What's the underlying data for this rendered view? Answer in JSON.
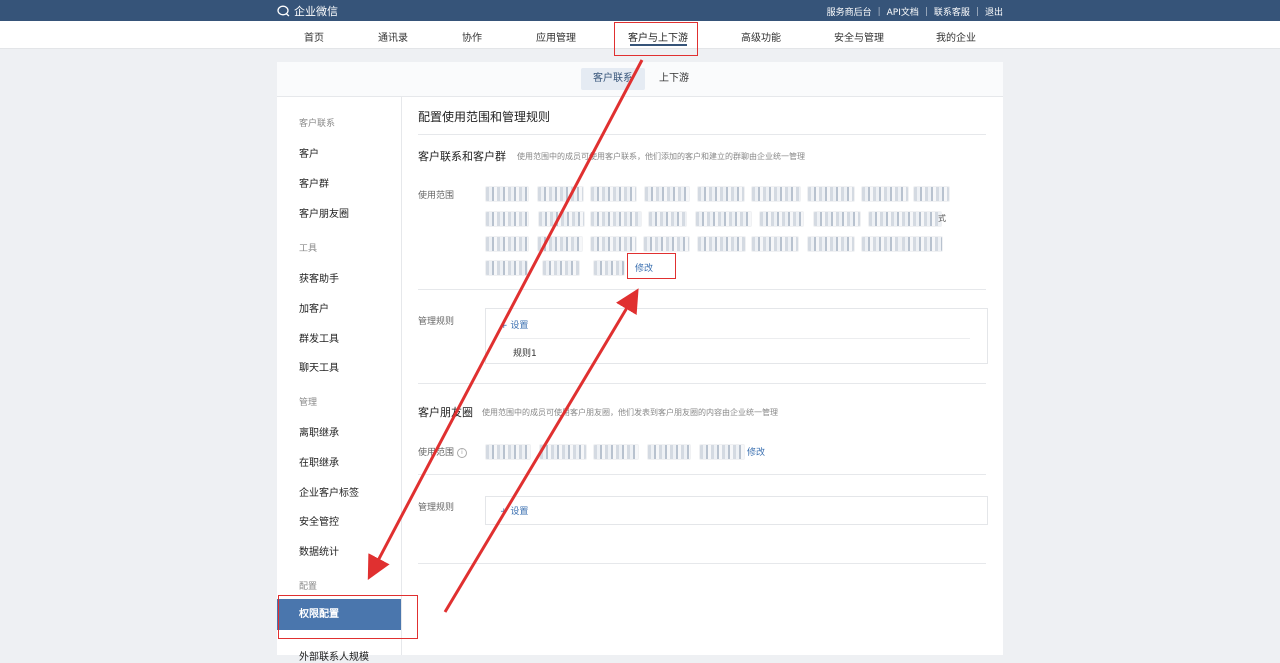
{
  "topbar": {
    "logo_text": "企业微信",
    "links": [
      "服务商后台",
      "API文档",
      "联系客服",
      "退出"
    ]
  },
  "nav": {
    "items": [
      "首页",
      "通讯录",
      "协作",
      "应用管理",
      "客户与上下游",
      "高级功能",
      "安全与管理",
      "我的企业"
    ],
    "active_index": 4
  },
  "subtabs": [
    "客户联系",
    "上下游"
  ],
  "sidebar": {
    "group_customer": "客户联系",
    "item_customer": "客户",
    "item_customer_group": "客户群",
    "item_moments": "客户朋友圈",
    "group_tools": "工具",
    "item_acquire": "获客助手",
    "item_add_customer": "加客户",
    "item_mass_send": "群发工具",
    "item_chat_tools": "聊天工具",
    "group_manage": "管理",
    "item_resign_inherit": "离职继承",
    "item_onjob_inherit": "在职继承",
    "item_tags": "企业客户标签",
    "item_security": "安全管控",
    "item_stats": "数据统计",
    "group_config": "配置",
    "item_permission": "权限配置",
    "item_partial": "外部联系人规模"
  },
  "main": {
    "title": "配置使用范围和管理规则",
    "section1": {
      "title": "客户联系和客户群",
      "desc": "使用范围中的成员可使用客户联系，他们添加的客户和建立的群聊由企业统一管理",
      "scope_label": "使用范围",
      "edit_link": "修改",
      "rules_label": "管理规则",
      "settings_link": "设置",
      "rule_item": "规则1",
      "chip_tail": "式"
    },
    "section2": {
      "title": "客户朋友圈",
      "desc": "使用范围中的成员可使用客户朋友圈，他们发表到客户朋友圈的内容由企业统一管理",
      "scope_label": "使用范围",
      "info_icon": "i",
      "edit_link": "修改",
      "rules_label": "管理规则",
      "settings_link": "设置",
      "plus": "+"
    }
  },
  "colors": {
    "topbar": "#365479",
    "accent": "#3a6fb0",
    "sidebar_active": "#4a76ad",
    "annotation_red": "#e03030"
  }
}
